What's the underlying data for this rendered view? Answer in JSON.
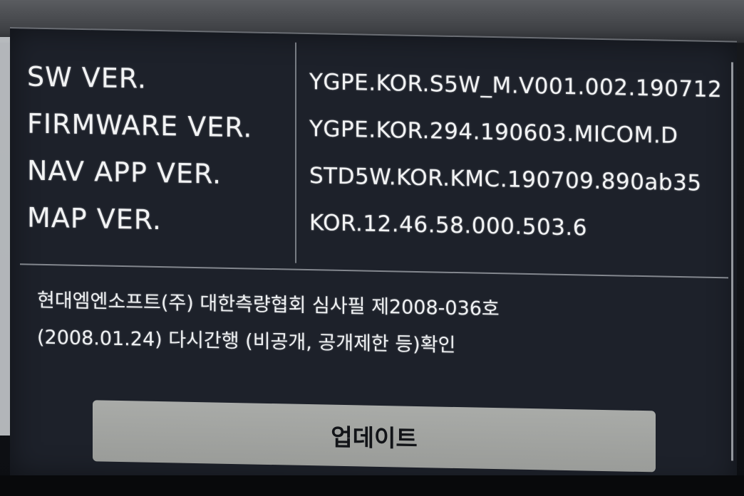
{
  "version_info": {
    "rows": [
      {
        "label": "SW VER.",
        "value": "YGPE.KOR.S5W_M.V001.002.190712"
      },
      {
        "label": "FIRMWARE VER.",
        "value": "YGPE.KOR.294.190603.MICOM.D"
      },
      {
        "label": "NAV APP VER.",
        "value": "STD5W.KOR.KMC.190709.890ab35"
      },
      {
        "label": "MAP VER.",
        "value": "KOR.12.46.58.000.503.6"
      }
    ]
  },
  "notice": {
    "line1": "현대엠엔소프트(주) 대한측량협회 심사필 제2008-036호",
    "line2": "(2008.01.24) 다시간행 (비공개, 공개제한 등)확인"
  },
  "actions": {
    "update_label": "업데이트"
  },
  "colors": {
    "screen_bg": "#1d212a",
    "text": "#f2f3f4",
    "button_bg": "#a9aba8",
    "button_text": "#121418"
  }
}
